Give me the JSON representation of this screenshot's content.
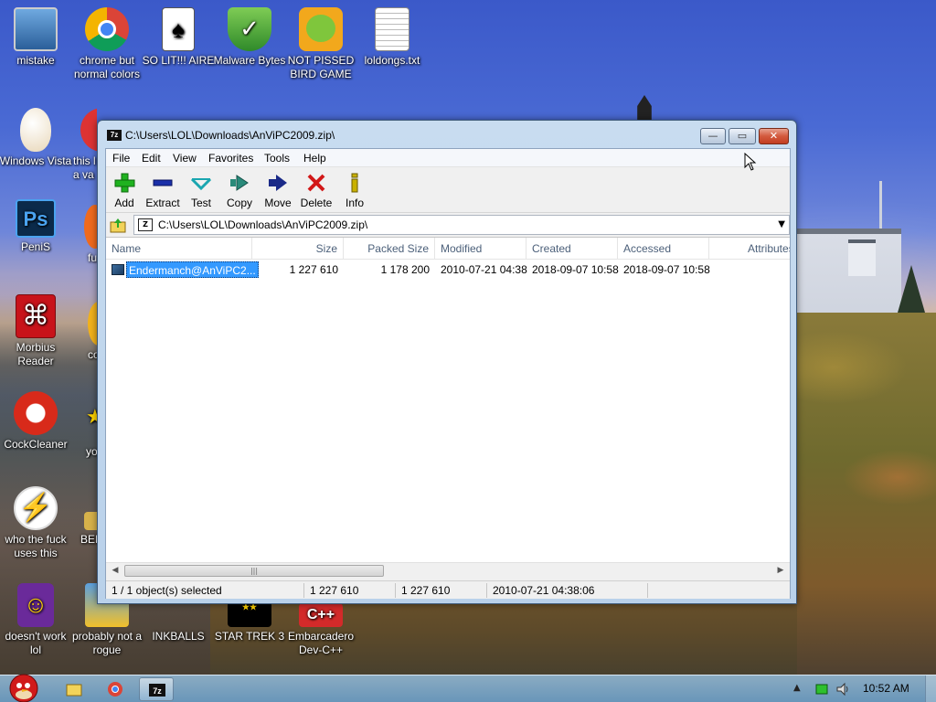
{
  "desktop": {
    "icons": [
      {
        "label": "mistake"
      },
      {
        "label": "chrome but normal colors"
      },
      {
        "label": "SO LIT!!! AIRE"
      },
      {
        "label": "Malware Bytes"
      },
      {
        "label": "NOT PISSED BIRD GAME"
      },
      {
        "label": "loldongs.txt"
      },
      {
        "label": "Windows Vista"
      },
      {
        "label": "this l a va"
      },
      {
        "label": "PeniS"
      },
      {
        "label": "fu"
      },
      {
        "label": "Morbius Reader"
      },
      {
        "label": "co"
      },
      {
        "label": "CockCleaner"
      },
      {
        "label": "yo"
      },
      {
        "label": "who the fuck uses this"
      },
      {
        "label": "BEE"
      },
      {
        "label": "doesn't work lol"
      },
      {
        "label": "probably not a rogue"
      },
      {
        "label": "INKBALLS"
      },
      {
        "label": "STAR TREK 3"
      },
      {
        "label": "Embarcadero Dev-C++"
      }
    ]
  },
  "window": {
    "title": "C:\\Users\\LOL\\Downloads\\AnViPC2009.zip\\",
    "app_icon_text": "7z",
    "controls": {
      "minimize": "—",
      "maximize": "▭",
      "close": "✕"
    },
    "menu": [
      "File",
      "Edit",
      "View",
      "Favorites",
      "Tools",
      "Help"
    ],
    "toolbar": [
      {
        "label": "Add",
        "icon": "plus-icon",
        "color": "#1fb21f"
      },
      {
        "label": "Extract",
        "icon": "minus-icon",
        "color": "#1a2fa8"
      },
      {
        "label": "Test",
        "icon": "check-icon",
        "color": "#1aa6b0"
      },
      {
        "label": "Copy",
        "icon": "copy-arrow-icon",
        "color": "#2a8a7a"
      },
      {
        "label": "Move",
        "icon": "move-arrow-icon",
        "color": "#1a2a88"
      },
      {
        "label": "Delete",
        "icon": "delete-x-icon",
        "color": "#d21818"
      },
      {
        "label": "Info",
        "icon": "info-icon",
        "color": "#c9b100"
      }
    ],
    "address": "C:\\Users\\LOL\\Downloads\\AnViPC2009.zip\\",
    "columns": [
      "Name",
      "Size",
      "Packed Size",
      "Modified",
      "Created",
      "Accessed",
      "Attributes"
    ],
    "files": [
      {
        "name": "Endermanch@AnViPC2...",
        "size": "1 227 610",
        "packed": "1 178 200",
        "modified": "2010-07-21 04:38",
        "created": "2018-09-07 10:58",
        "accessed": "2018-09-07 10:58",
        "attributes": ""
      }
    ],
    "status": {
      "selected": "1 / 1 object(s) selected",
      "size": "1 227 610",
      "packed": "1 227 610",
      "modified": "2010-07-21 04:38:06"
    }
  },
  "taskbar": {
    "clock": "10:52 AM",
    "tray_icons": [
      "show-hidden-icons-icon",
      "network-icon",
      "volume-icon"
    ]
  },
  "colors": {
    "selection": "#3399ff",
    "header_text": "#4c607a"
  }
}
